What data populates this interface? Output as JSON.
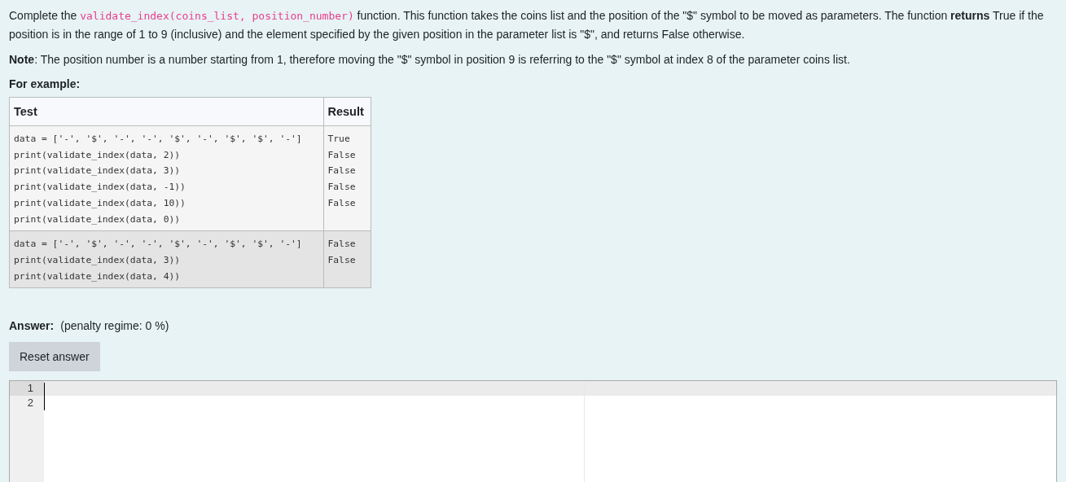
{
  "intro": [
    {
      "kind": "plain",
      "text": "Complete the "
    },
    {
      "kind": "code",
      "text": "validate_index(coins_list, position_number)"
    },
    {
      "kind": "plain",
      "text": " function. This function takes the coins list and the position of the \"$\" symbol to be moved as parameters. The function **returns** True if the position is in the range of 1 to 9 (inclusive) and the element specified by the given position in the parameter list is \"$\", and returns False otherwise."
    }
  ],
  "note": "**Note**: The position number is a number starting from 1, therefore moving the \"$\" symbol in position 9 is referring to the \"$\" symbol at index 8 of the parameter coins list.",
  "example_heading": "For example:",
  "table": {
    "columns": [
      "Test",
      "Result"
    ],
    "rows": [
      {
        "test": "data = ['-', '$', '-', '-', '$', '-', '$', '$', '-']\nprint(validate_index(data, 2))\nprint(validate_index(data, 3))\nprint(validate_index(data, -1))\nprint(validate_index(data, 10))\nprint(validate_index(data, 0))",
        "result": "True\nFalse\nFalse\nFalse\nFalse"
      },
      {
        "test": "data = ['-', '$', '-', '-', '$', '-', '$', '$', '-']\nprint(validate_index(data, 3))\nprint(validate_index(data, 4))",
        "result": "False\nFalse"
      }
    ]
  },
  "answer": {
    "label": "Answer:",
    "penalty": "(penalty regime: 0 %)"
  },
  "reset_button": "Reset answer",
  "editor": {
    "lines": [
      {
        "number": "1",
        "active": true
      },
      {
        "number": "2",
        "active": false
      }
    ]
  }
}
